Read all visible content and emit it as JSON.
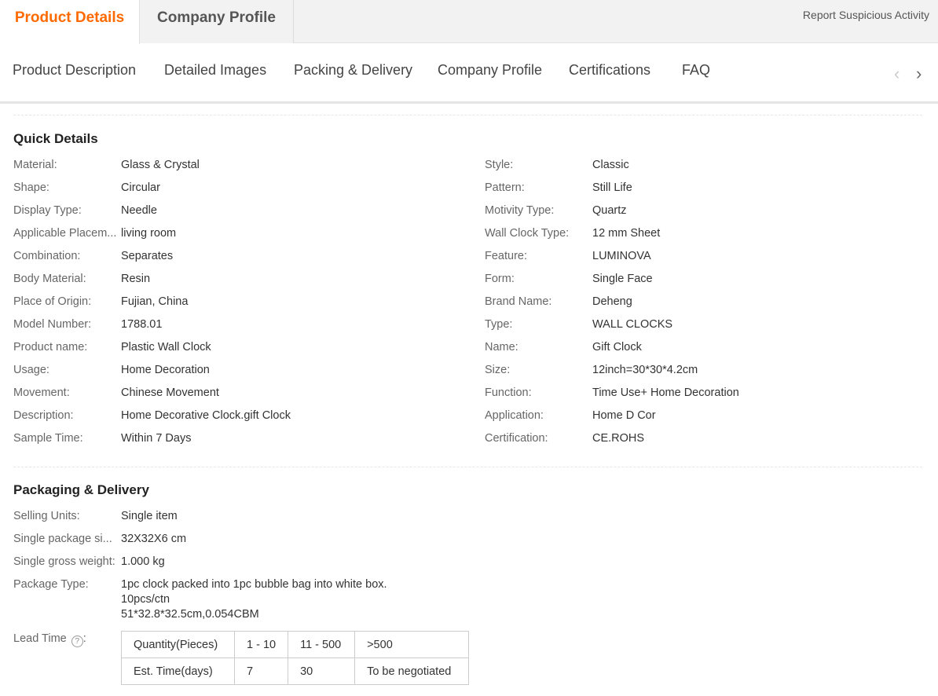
{
  "top_tabs": {
    "active": "Product Details",
    "inactive": "Company Profile",
    "report": "Report Suspicious Activity"
  },
  "sub_nav": {
    "items": [
      "Product Description",
      "Detailed Images",
      "Packing & Delivery",
      "Company Profile",
      "Certifications",
      "FAQ"
    ],
    "prev_icon": "chevron-left-icon",
    "next_icon": "chevron-right-icon"
  },
  "quick_details": {
    "title": "Quick Details",
    "left": [
      {
        "label": "Material:",
        "value": "Glass & Crystal"
      },
      {
        "label": "Shape:",
        "value": "Circular"
      },
      {
        "label": "Display Type:",
        "value": "Needle"
      },
      {
        "label": "Applicable Placem...",
        "value": "living room"
      },
      {
        "label": "Combination:",
        "value": "Separates"
      },
      {
        "label": "Body Material:",
        "value": "Resin"
      },
      {
        "label": "Place of Origin:",
        "value": "Fujian, China"
      },
      {
        "label": "Model Number:",
        "value": "1788.01"
      },
      {
        "label": "Product name:",
        "value": "Plastic Wall Clock"
      },
      {
        "label": "Usage:",
        "value": "Home Decoration"
      },
      {
        "label": "Movement:",
        "value": "Chinese Movement"
      },
      {
        "label": "Description:",
        "value": "Home Decorative Clock.gift Clock"
      },
      {
        "label": "Sample Time:",
        "value": "Within 7 Days"
      }
    ],
    "right": [
      {
        "label": "Style:",
        "value": "Classic"
      },
      {
        "label": "Pattern:",
        "value": "Still Life"
      },
      {
        "label": "Motivity Type:",
        "value": "Quartz"
      },
      {
        "label": "Wall Clock Type:",
        "value": "12 mm Sheet"
      },
      {
        "label": "Feature:",
        "value": "LUMINOVA"
      },
      {
        "label": "Form:",
        "value": "Single Face"
      },
      {
        "label": "Brand Name:",
        "value": "Deheng"
      },
      {
        "label": "Type:",
        "value": "WALL CLOCKS"
      },
      {
        "label": "Name:",
        "value": "Gift Clock"
      },
      {
        "label": "Size:",
        "value": "12inch=30*30*4.2cm"
      },
      {
        "label": "Function:",
        "value": "Time Use+ Home Decoration"
      },
      {
        "label": "Application:",
        "value": "Home D Cor"
      },
      {
        "label": "Certification:",
        "value": "CE.ROHS"
      }
    ]
  },
  "packaging": {
    "title": "Packaging & Delivery",
    "rows": [
      {
        "label": "Selling Units:",
        "value": "Single item"
      },
      {
        "label": "Single package si...",
        "value": "32X32X6 cm"
      },
      {
        "label": "Single gross weight:",
        "value": "1.000 kg"
      }
    ],
    "package_type": {
      "label": "Package Type:",
      "lines": [
        "1pc clock packed into 1pc bubble bag into white box.",
        "10pcs/ctn",
        "51*32.8*32.5cm,0.054CBM"
      ]
    },
    "lead_time": {
      "label": "Lead Time",
      "help_icon": "question-icon",
      "colon": ":",
      "table": {
        "rows": [
          [
            "Quantity(Pieces)",
            "1 - 10",
            "11 - 500",
            ">500"
          ],
          [
            "Est. Time(days)",
            "7",
            "30",
            "To be negotiated"
          ]
        ]
      }
    }
  },
  "colors": {
    "accent": "#ff6a00"
  }
}
